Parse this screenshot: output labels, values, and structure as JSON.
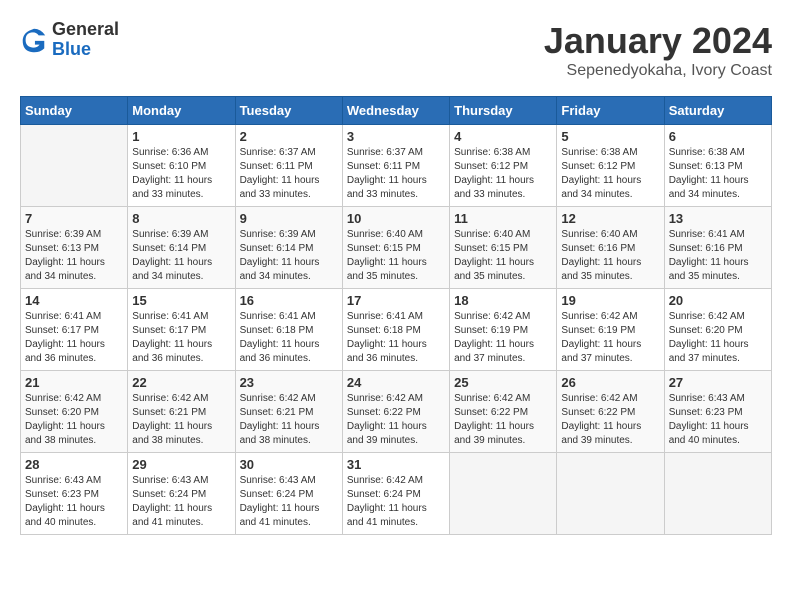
{
  "logo": {
    "general": "General",
    "blue": "Blue"
  },
  "title": "January 2024",
  "subtitle": "Sepenedyokaha, Ivory Coast",
  "days_header": [
    "Sunday",
    "Monday",
    "Tuesday",
    "Wednesday",
    "Thursday",
    "Friday",
    "Saturday"
  ],
  "weeks": [
    [
      {
        "day": "",
        "sunrise": "",
        "sunset": "",
        "daylight": ""
      },
      {
        "day": "1",
        "sunrise": "Sunrise: 6:36 AM",
        "sunset": "Sunset: 6:10 PM",
        "daylight": "Daylight: 11 hours and 33 minutes."
      },
      {
        "day": "2",
        "sunrise": "Sunrise: 6:37 AM",
        "sunset": "Sunset: 6:11 PM",
        "daylight": "Daylight: 11 hours and 33 minutes."
      },
      {
        "day": "3",
        "sunrise": "Sunrise: 6:37 AM",
        "sunset": "Sunset: 6:11 PM",
        "daylight": "Daylight: 11 hours and 33 minutes."
      },
      {
        "day": "4",
        "sunrise": "Sunrise: 6:38 AM",
        "sunset": "Sunset: 6:12 PM",
        "daylight": "Daylight: 11 hours and 33 minutes."
      },
      {
        "day": "5",
        "sunrise": "Sunrise: 6:38 AM",
        "sunset": "Sunset: 6:12 PM",
        "daylight": "Daylight: 11 hours and 34 minutes."
      },
      {
        "day": "6",
        "sunrise": "Sunrise: 6:38 AM",
        "sunset": "Sunset: 6:13 PM",
        "daylight": "Daylight: 11 hours and 34 minutes."
      }
    ],
    [
      {
        "day": "7",
        "sunrise": "Sunrise: 6:39 AM",
        "sunset": "Sunset: 6:13 PM",
        "daylight": "Daylight: 11 hours and 34 minutes."
      },
      {
        "day": "8",
        "sunrise": "Sunrise: 6:39 AM",
        "sunset": "Sunset: 6:14 PM",
        "daylight": "Daylight: 11 hours and 34 minutes."
      },
      {
        "day": "9",
        "sunrise": "Sunrise: 6:39 AM",
        "sunset": "Sunset: 6:14 PM",
        "daylight": "Daylight: 11 hours and 34 minutes."
      },
      {
        "day": "10",
        "sunrise": "Sunrise: 6:40 AM",
        "sunset": "Sunset: 6:15 PM",
        "daylight": "Daylight: 11 hours and 35 minutes."
      },
      {
        "day": "11",
        "sunrise": "Sunrise: 6:40 AM",
        "sunset": "Sunset: 6:15 PM",
        "daylight": "Daylight: 11 hours and 35 minutes."
      },
      {
        "day": "12",
        "sunrise": "Sunrise: 6:40 AM",
        "sunset": "Sunset: 6:16 PM",
        "daylight": "Daylight: 11 hours and 35 minutes."
      },
      {
        "day": "13",
        "sunrise": "Sunrise: 6:41 AM",
        "sunset": "Sunset: 6:16 PM",
        "daylight": "Daylight: 11 hours and 35 minutes."
      }
    ],
    [
      {
        "day": "14",
        "sunrise": "Sunrise: 6:41 AM",
        "sunset": "Sunset: 6:17 PM",
        "daylight": "Daylight: 11 hours and 36 minutes."
      },
      {
        "day": "15",
        "sunrise": "Sunrise: 6:41 AM",
        "sunset": "Sunset: 6:17 PM",
        "daylight": "Daylight: 11 hours and 36 minutes."
      },
      {
        "day": "16",
        "sunrise": "Sunrise: 6:41 AM",
        "sunset": "Sunset: 6:18 PM",
        "daylight": "Daylight: 11 hours and 36 minutes."
      },
      {
        "day": "17",
        "sunrise": "Sunrise: 6:41 AM",
        "sunset": "Sunset: 6:18 PM",
        "daylight": "Daylight: 11 hours and 36 minutes."
      },
      {
        "day": "18",
        "sunrise": "Sunrise: 6:42 AM",
        "sunset": "Sunset: 6:19 PM",
        "daylight": "Daylight: 11 hours and 37 minutes."
      },
      {
        "day": "19",
        "sunrise": "Sunrise: 6:42 AM",
        "sunset": "Sunset: 6:19 PM",
        "daylight": "Daylight: 11 hours and 37 minutes."
      },
      {
        "day": "20",
        "sunrise": "Sunrise: 6:42 AM",
        "sunset": "Sunset: 6:20 PM",
        "daylight": "Daylight: 11 hours and 37 minutes."
      }
    ],
    [
      {
        "day": "21",
        "sunrise": "Sunrise: 6:42 AM",
        "sunset": "Sunset: 6:20 PM",
        "daylight": "Daylight: 11 hours and 38 minutes."
      },
      {
        "day": "22",
        "sunrise": "Sunrise: 6:42 AM",
        "sunset": "Sunset: 6:21 PM",
        "daylight": "Daylight: 11 hours and 38 minutes."
      },
      {
        "day": "23",
        "sunrise": "Sunrise: 6:42 AM",
        "sunset": "Sunset: 6:21 PM",
        "daylight": "Daylight: 11 hours and 38 minutes."
      },
      {
        "day": "24",
        "sunrise": "Sunrise: 6:42 AM",
        "sunset": "Sunset: 6:22 PM",
        "daylight": "Daylight: 11 hours and 39 minutes."
      },
      {
        "day": "25",
        "sunrise": "Sunrise: 6:42 AM",
        "sunset": "Sunset: 6:22 PM",
        "daylight": "Daylight: 11 hours and 39 minutes."
      },
      {
        "day": "26",
        "sunrise": "Sunrise: 6:42 AM",
        "sunset": "Sunset: 6:22 PM",
        "daylight": "Daylight: 11 hours and 39 minutes."
      },
      {
        "day": "27",
        "sunrise": "Sunrise: 6:43 AM",
        "sunset": "Sunset: 6:23 PM",
        "daylight": "Daylight: 11 hours and 40 minutes."
      }
    ],
    [
      {
        "day": "28",
        "sunrise": "Sunrise: 6:43 AM",
        "sunset": "Sunset: 6:23 PM",
        "daylight": "Daylight: 11 hours and 40 minutes."
      },
      {
        "day": "29",
        "sunrise": "Sunrise: 6:43 AM",
        "sunset": "Sunset: 6:24 PM",
        "daylight": "Daylight: 11 hours and 41 minutes."
      },
      {
        "day": "30",
        "sunrise": "Sunrise: 6:43 AM",
        "sunset": "Sunset: 6:24 PM",
        "daylight": "Daylight: 11 hours and 41 minutes."
      },
      {
        "day": "31",
        "sunrise": "Sunrise: 6:42 AM",
        "sunset": "Sunset: 6:24 PM",
        "daylight": "Daylight: 11 hours and 41 minutes."
      },
      {
        "day": "",
        "sunrise": "",
        "sunset": "",
        "daylight": ""
      },
      {
        "day": "",
        "sunrise": "",
        "sunset": "",
        "daylight": ""
      },
      {
        "day": "",
        "sunrise": "",
        "sunset": "",
        "daylight": ""
      }
    ]
  ]
}
